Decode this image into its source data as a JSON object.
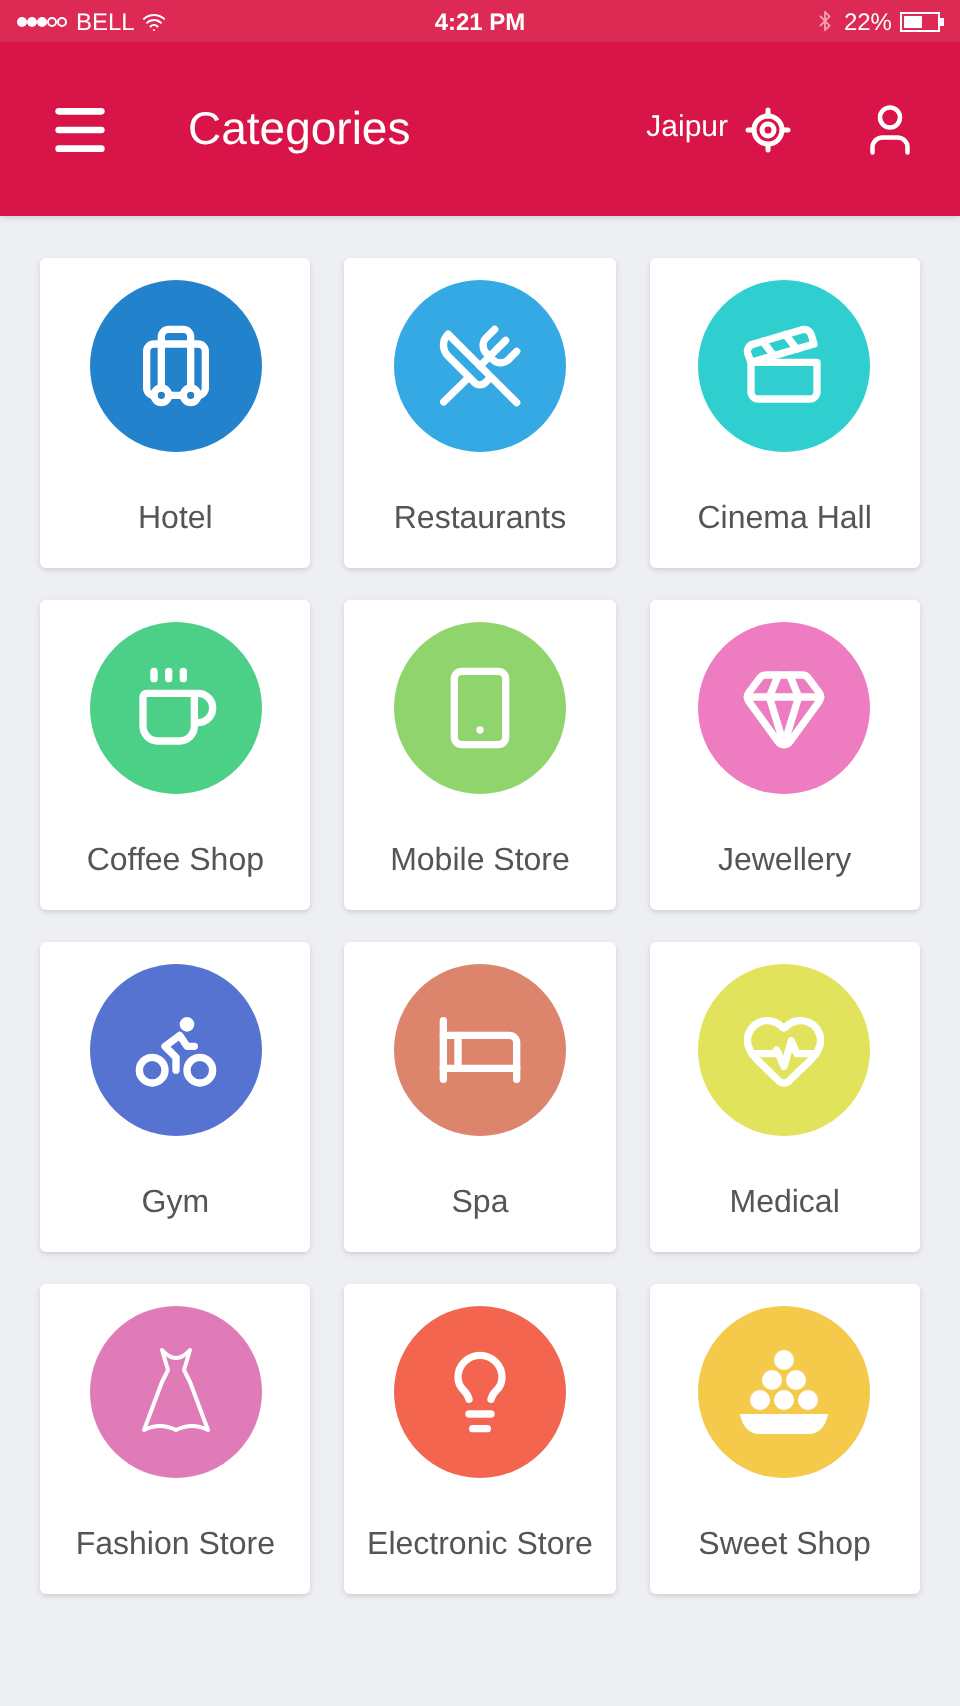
{
  "status_bar": {
    "carrier": "BELL",
    "time": "4:21 PM",
    "battery": "22%"
  },
  "header": {
    "title": "Categories",
    "location": "Jaipur"
  },
  "categories": [
    {
      "label": "Hotel",
      "color": "#2283cc"
    },
    {
      "label": "Restaurants",
      "color": "#35a9e4"
    },
    {
      "label": "Cinema Hall",
      "color": "#2fcfcf"
    },
    {
      "label": "Coffee Shop",
      "color": "#4ccf86"
    },
    {
      "label": "Mobile Store",
      "color": "#8fd46d"
    },
    {
      "label": "Jewellery",
      "color": "#ed7cc0"
    },
    {
      "label": "Gym",
      "color": "#5673d1"
    },
    {
      "label": "Spa",
      "color": "#dc856c"
    },
    {
      "label": "Medical",
      "color": "#e1e35c"
    },
    {
      "label": "Fashion Store",
      "color": "#e07bb8"
    },
    {
      "label": "Electronic Store",
      "color": "#f3654f"
    },
    {
      "label": "Sweet Shop",
      "color": "#f5c94a"
    }
  ]
}
